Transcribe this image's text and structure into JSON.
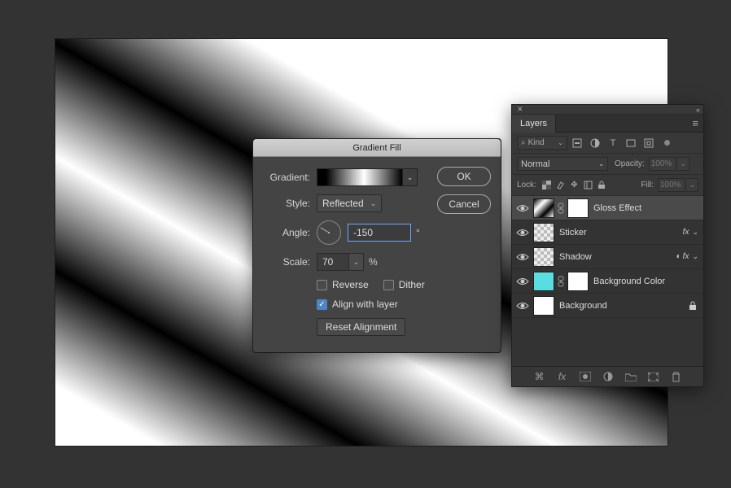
{
  "dialog": {
    "title": "Gradient Fill",
    "gradient_label": "Gradient:",
    "style_label": "Style:",
    "style_value": "Reflected",
    "angle_label": "Angle:",
    "angle_value": "-150",
    "angle_unit": "°",
    "scale_label": "Scale:",
    "scale_value": "70",
    "scale_unit": "%",
    "reverse_label": "Reverse",
    "reverse_checked": false,
    "dither_label": "Dither",
    "dither_checked": false,
    "align_label": "Align with layer",
    "align_checked": true,
    "reset_label": "Reset Alignment",
    "ok_label": "OK",
    "cancel_label": "Cancel"
  },
  "layers_panel": {
    "tab_label": "Layers",
    "kind_label": "Kind",
    "blend_mode": "Normal",
    "opacity_label": "Opacity:",
    "opacity_value": "100%",
    "lock_label": "Lock:",
    "fill_label": "Fill:",
    "fill_value": "100%",
    "layers": [
      {
        "name": "Gloss Effect",
        "selected": true,
        "has_fx": false,
        "thumbs": [
          "grad",
          "white"
        ],
        "linked": true,
        "locked": false
      },
      {
        "name": "Sticker",
        "selected": false,
        "has_fx": true,
        "thumbs": [
          "checker"
        ],
        "linked": false,
        "locked": false
      },
      {
        "name": "Shadow",
        "selected": false,
        "has_fx": true,
        "fx_extra": true,
        "thumbs": [
          "checker"
        ],
        "linked": false,
        "locked": false
      },
      {
        "name": "Background Color",
        "selected": false,
        "has_fx": false,
        "thumbs": [
          "cyan",
          "white"
        ],
        "linked": true,
        "locked": false
      },
      {
        "name": "Background",
        "selected": false,
        "has_fx": false,
        "thumbs": [
          "white"
        ],
        "linked": false,
        "locked": true
      }
    ]
  }
}
